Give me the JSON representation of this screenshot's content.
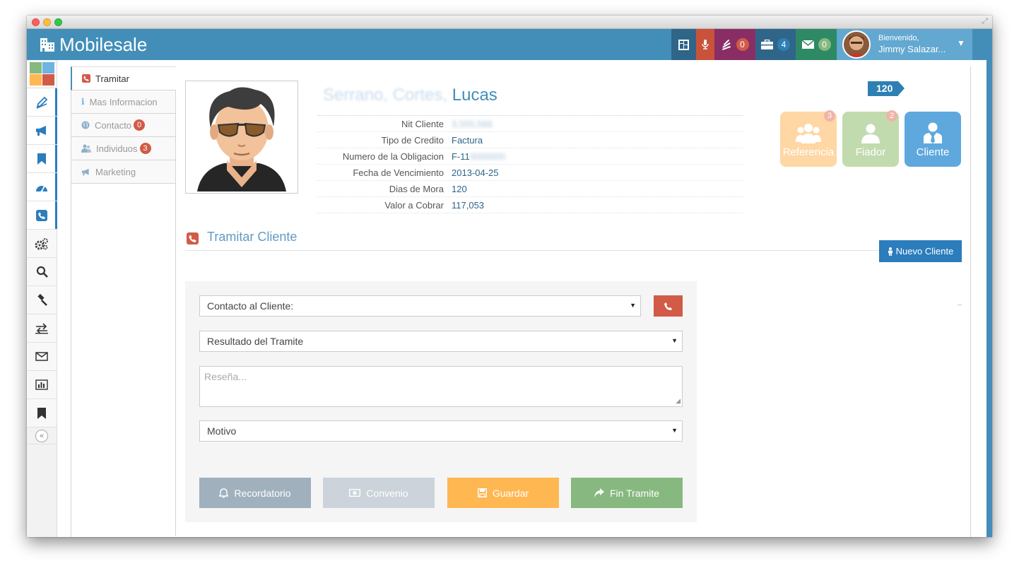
{
  "app": {
    "title": "Mobilesale"
  },
  "colors": {
    "primary": "#438eb9",
    "danger": "#d15b47",
    "warning": "#ffb752",
    "success": "#87b87f",
    "purple": "#892e65"
  },
  "topnav": {
    "tasks_count": "0",
    "briefcase_count": "4",
    "mail_count": "0",
    "user": {
      "greeting": "Bienvenido,",
      "name": "Jimmy Salazar..."
    }
  },
  "sidebar": {
    "icons": [
      "pencil-icon",
      "megaphone-icon",
      "bookmark-icon",
      "dashboard-icon",
      "phone-icon",
      "cogs-icon",
      "search-icon",
      "gavel-icon",
      "exchange-icon",
      "envelope-icon",
      "bar-chart-icon",
      "bookmark-icon"
    ],
    "collapse_label": "«"
  },
  "tabs": [
    {
      "label": "Tramitar"
    },
    {
      "label": "Mas Informacion"
    },
    {
      "label": "Contacto",
      "badge": "0"
    },
    {
      "label": "Individuos",
      "badge": "3"
    },
    {
      "label": "Marketing"
    }
  ],
  "client": {
    "name_redacted": "Serrano, Cortes,",
    "name_first": "Lucas",
    "fields": [
      {
        "label": "Nit Cliente",
        "value": "3,555,566",
        "redacted": true
      },
      {
        "label": "Tipo de Credito",
        "value": "Factura"
      },
      {
        "label": "Numero de la Obligacion",
        "value": "F-11",
        "suffix": "0000000",
        "redacted_suffix": true
      },
      {
        "label": "Fecha de Vencimiento",
        "value": "2013-04-25"
      },
      {
        "label": "Dias de Mora",
        "value": "120"
      },
      {
        "label": "Valor a Cobrar",
        "value": "117,053"
      }
    ],
    "days_badge": "120"
  },
  "roles": [
    {
      "label": "Referencia",
      "badge": "3"
    },
    {
      "label": "Fiador",
      "badge": "2"
    },
    {
      "label": "Cliente"
    }
  ],
  "section": {
    "title": "Tramitar Cliente",
    "new_button": "Nuevo Cliente"
  },
  "form": {
    "contacto": "Contacto al Cliente:",
    "resultado": "Resultado del Tramite",
    "resena_placeholder": "Reseña...",
    "motivo": "Motivo"
  },
  "actions": [
    {
      "label": "Recordatorio"
    },
    {
      "label": "Convenio"
    },
    {
      "label": "Guardar"
    },
    {
      "label": "Fin Tramite"
    }
  ]
}
